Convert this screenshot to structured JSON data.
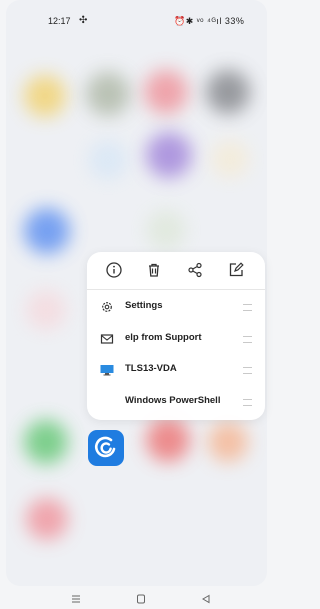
{
  "status_bar": {
    "time": "12:17",
    "right_indicators": "⏰✱ ᵛᵒ ⁴ᴳıl 33%"
  },
  "quick_actions": {
    "info_icon": "info-icon",
    "delete_icon": "trash-icon",
    "share_icon": "share-icon",
    "edit_icon": "edit-icon"
  },
  "shortcuts": [
    {
      "label": "Settings",
      "icon": "gear-icon"
    },
    {
      "label": "elp from Support",
      "icon": "mail-icon"
    },
    {
      "label": "TLS13-VDA",
      "icon": "monitor-icon"
    },
    {
      "label": "Windows PowerShell",
      "icon": ""
    }
  ],
  "colors": {
    "app_icon": "#1f7ce0",
    "monitor": "#2a8be0"
  }
}
